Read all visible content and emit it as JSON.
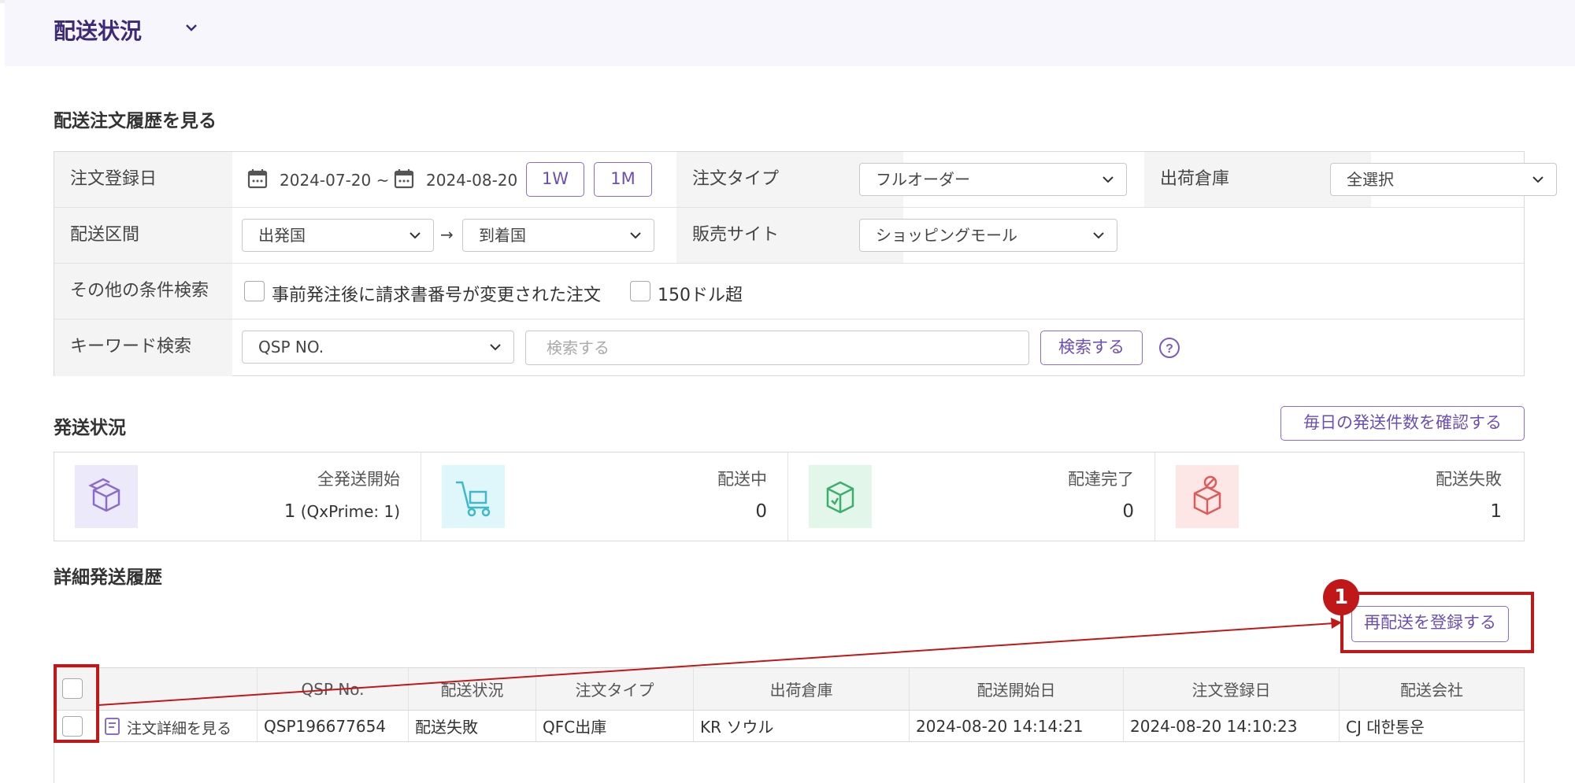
{
  "header": {
    "title": "配送状況"
  },
  "search": {
    "section_title": "配送注文履歴を見る",
    "order_date": {
      "label": "注文登録日",
      "from": "2024-07-20 ~",
      "to": "2024-08-20",
      "btn_1w": "1W",
      "btn_1m": "1M"
    },
    "order_type": {
      "label": "注文タイプ",
      "value": "フルオーダー"
    },
    "warehouse": {
      "label": "出荷倉庫",
      "value": "全選択"
    },
    "route": {
      "label": "配送区間",
      "from": "出発国",
      "arrow": "→",
      "to": "到着国"
    },
    "sales_site": {
      "label": "販売サイト",
      "value": "ショッピングモール"
    },
    "other": {
      "label": "その他の条件検索",
      "check1": "事前発注後に請求書番号が変更された注文",
      "check2": "150ドル超"
    },
    "keyword": {
      "label": "キーワード検索",
      "type": "QSP NO.",
      "placeholder": "検索する",
      "button": "検索する"
    }
  },
  "status": {
    "section_title": "発送状況",
    "daily_button": "毎日の発送件数を確認する",
    "cards": [
      {
        "label": "全発送開始",
        "value": "1",
        "sub": " (QxPrime: 1)",
        "icon": "box-icon",
        "color": "#ece9fb"
      },
      {
        "label": "配送中",
        "value": "0",
        "icon": "cart-icon",
        "color": "#dff6fb"
      },
      {
        "label": "配達完了",
        "value": "0",
        "icon": "box-check-icon",
        "color": "#e2f6ea"
      },
      {
        "label": "配送失敗",
        "value": "1",
        "icon": "box-fail-icon",
        "color": "#fde6e6"
      }
    ]
  },
  "detail": {
    "section_title": "詳細発送履歴",
    "reship_button": "再配送を登録する",
    "columns": [
      "",
      "QSP No.",
      "配送状況",
      "注文タイプ",
      "出荷倉庫",
      "配送開始日",
      "注文登録日",
      "配送会社"
    ],
    "rows": [
      {
        "link": "注文詳細を見る",
        "qsp": "QSP196677654",
        "status": "配送失敗",
        "type": "QFC出庫",
        "warehouse": "KR ソウル",
        "ship_date": "2024-08-20 14:14:21",
        "order_date": "2024-08-20 14:10:23",
        "carrier": "CJ 대한통운"
      }
    ]
  },
  "annotation": {
    "number": "1"
  }
}
